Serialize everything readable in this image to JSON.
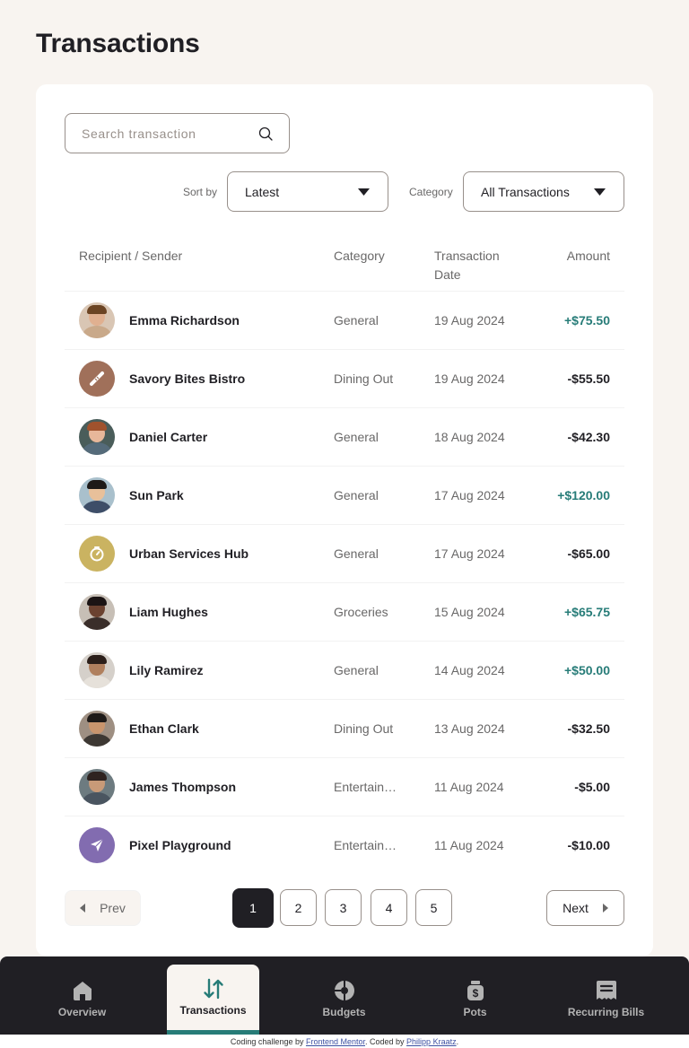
{
  "page": {
    "title": "Transactions"
  },
  "search": {
    "placeholder": "Search transaction",
    "icon": "search-icon"
  },
  "filters": {
    "sort_label": "Sort by",
    "sort_value": "Latest",
    "category_label": "Category",
    "category_value": "All Transactions"
  },
  "table": {
    "headers": {
      "recipient": "Recipient / Sender",
      "category": "Category",
      "date": "Transaction Date",
      "amount": "Amount"
    },
    "rows": [
      {
        "name": "Emma Richardson",
        "category": "General",
        "date": "19 Aug 2024",
        "amount": "+$75.50",
        "positive": true,
        "avatar": {
          "type": "photo",
          "skin": "#E0B090",
          "hair": "#6B4423",
          "shirt": "#C9A98A",
          "bg": "#D9C6B4"
        }
      },
      {
        "name": "Savory Bites Bistro",
        "category": "Dining Out",
        "date": "19 Aug 2024",
        "amount": "-$55.50",
        "positive": false,
        "avatar": {
          "type": "logo",
          "bg": "#A0705A",
          "icon": "baguette-icon"
        }
      },
      {
        "name": "Daniel Carter",
        "category": "General",
        "date": "18 Aug 2024",
        "amount": "-$42.30",
        "positive": false,
        "avatar": {
          "type": "photo",
          "skin": "#E7B79A",
          "hair": "#A0522D",
          "shirt": "#556B7A",
          "bg": "#4A5D5A"
        }
      },
      {
        "name": "Sun Park",
        "category": "General",
        "date": "17 Aug 2024",
        "amount": "+$120.00",
        "positive": true,
        "avatar": {
          "type": "photo",
          "skin": "#E8C09A",
          "hair": "#1E1A18",
          "shirt": "#3E4E68",
          "bg": "#A9C0CC"
        }
      },
      {
        "name": "Urban Services Hub",
        "category": "General",
        "date": "17 Aug 2024",
        "amount": "-$65.00",
        "positive": false,
        "avatar": {
          "type": "logo",
          "bg": "#CAB361",
          "icon": "timer-icon"
        }
      },
      {
        "name": "Liam Hughes",
        "category": "Groceries",
        "date": "15 Aug 2024",
        "amount": "+$65.75",
        "positive": true,
        "avatar": {
          "type": "photo",
          "skin": "#6B4230",
          "hair": "#1B1414",
          "shirt": "#3A2E2A",
          "bg": "#C7BFB6"
        }
      },
      {
        "name": "Lily Ramirez",
        "category": "General",
        "date": "14 Aug 2024",
        "amount": "+$50.00",
        "positive": true,
        "avatar": {
          "type": "photo",
          "skin": "#B0805E",
          "hair": "#2B1F1A",
          "shirt": "#E6E1DA",
          "bg": "#D5D0CA"
        }
      },
      {
        "name": "Ethan Clark",
        "category": "Dining Out",
        "date": "13 Aug 2024",
        "amount": "-$32.50",
        "positive": false,
        "avatar": {
          "type": "photo",
          "skin": "#C9956D",
          "hair": "#1E1A18",
          "shirt": "#3D3833",
          "bg": "#9E8F82"
        }
      },
      {
        "name": "James Thompson",
        "category": "Entertainment",
        "date": "11 Aug 2024",
        "amount": "-$5.00",
        "positive": false,
        "avatar": {
          "type": "photo",
          "skin": "#C89A78",
          "hair": "#2E2320",
          "shirt": "#4A5560",
          "bg": "#6D7B80"
        }
      },
      {
        "name": "Pixel Playground",
        "category": "Entertainment",
        "date": "11 Aug 2024",
        "amount": "-$10.00",
        "positive": false,
        "avatar": {
          "type": "logo",
          "bg": "#826CB0",
          "icon": "paper-plane-icon"
        }
      }
    ]
  },
  "pagination": {
    "prev_label": "Prev",
    "next_label": "Next",
    "pages": [
      "1",
      "2",
      "3",
      "4",
      "5"
    ],
    "current": "1"
  },
  "nav": {
    "items": [
      {
        "label": "Overview",
        "icon": "home-icon",
        "active": false
      },
      {
        "label": "Transactions",
        "icon": "arrows-up-down-icon",
        "active": true
      },
      {
        "label": "Budgets",
        "icon": "pie-chart-icon",
        "active": false
      },
      {
        "label": "Pots",
        "icon": "jar-icon",
        "active": false
      },
      {
        "label": "Recurring Bills",
        "icon": "receipt-icon",
        "active": false
      }
    ]
  },
  "attribution": {
    "prefix": "Coding challenge by ",
    "link1": "Frontend Mentor",
    "middle": ". Coded by ",
    "link2": "Philipp Kraatz",
    "suffix": "."
  },
  "colors": {
    "positive": "#277C78",
    "dark": "#201F24",
    "muted": "#696868",
    "background": "#F8F4F0"
  }
}
